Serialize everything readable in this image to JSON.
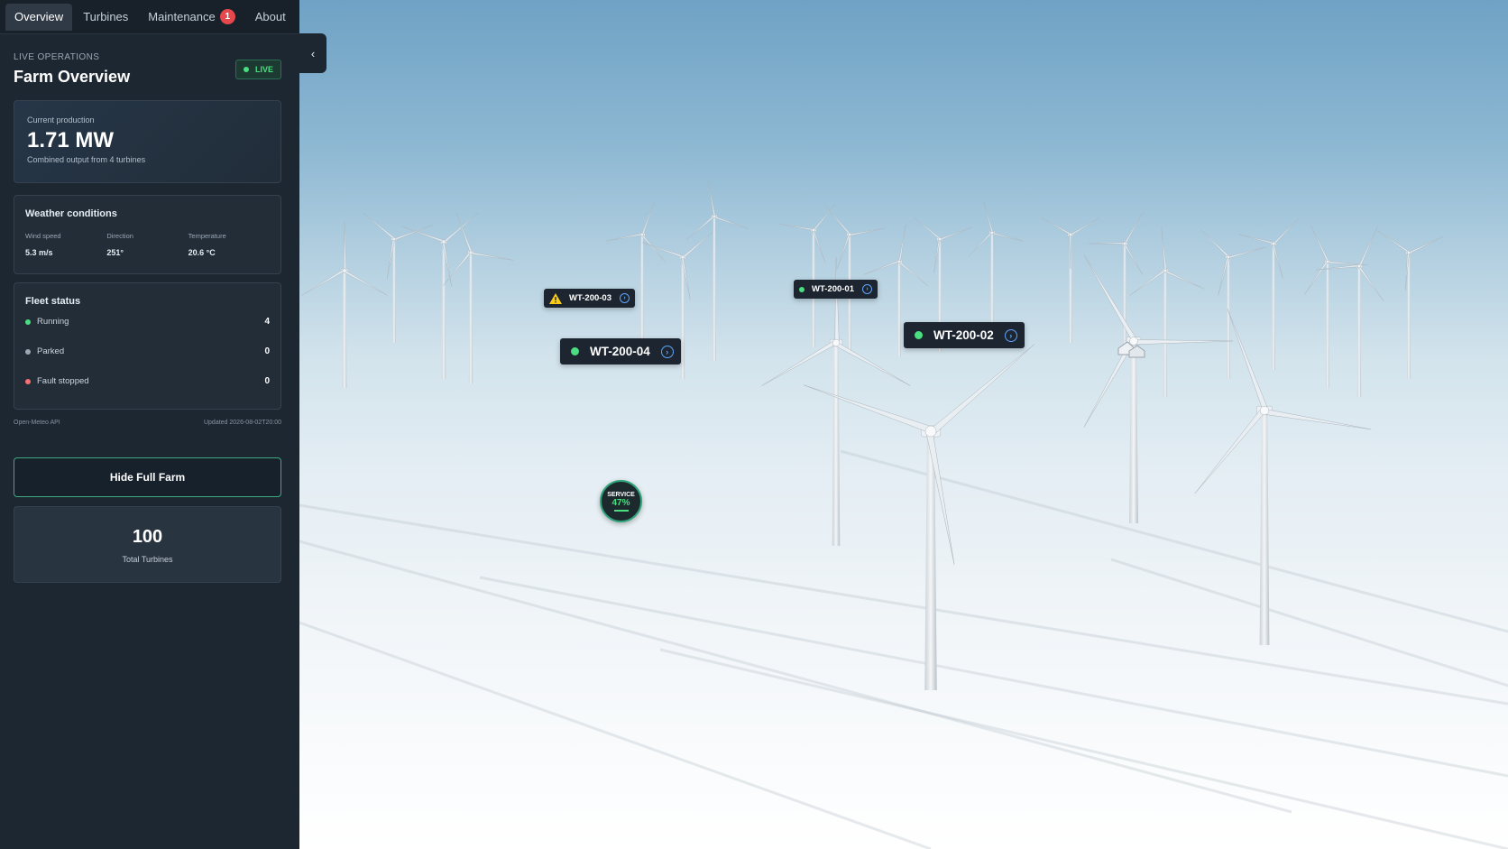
{
  "tabs": [
    {
      "label": "Overview",
      "active": true
    },
    {
      "label": "Turbines",
      "active": false
    },
    {
      "label": "Maintenance",
      "active": false,
      "badge": "1"
    },
    {
      "label": "About",
      "active": false
    }
  ],
  "header": {
    "eyebrow": "LIVE OPERATIONS",
    "title": "Farm Overview",
    "live_label": "LIVE"
  },
  "production": {
    "label": "Current production",
    "value": "1.71 MW",
    "sub": "Combined output from 4 turbines"
  },
  "weather": {
    "title": "Weather conditions",
    "items": [
      {
        "label": "Wind speed",
        "value": "5.3 m/s"
      },
      {
        "label": "Direction",
        "value": "251°"
      },
      {
        "label": "Temperature",
        "value": "20.6 °C"
      }
    ]
  },
  "fleet": {
    "title": "Fleet status",
    "items": [
      {
        "label": "Running",
        "count": "4",
        "color": "#4ade80"
      },
      {
        "label": "Parked",
        "count": "0",
        "color": "#9aa7b4"
      },
      {
        "label": "Fault stopped",
        "count": "0",
        "color": "#f87171"
      }
    ]
  },
  "meta": {
    "source": "Open-Meteo API",
    "updated": "Updated 2026-08-02T20:00"
  },
  "actions": {
    "hide_farm": "Hide Full Farm"
  },
  "total": {
    "value": "100",
    "label": "Total Turbines"
  },
  "turbines": [
    {
      "id": "WT-200-03",
      "status": "warning"
    },
    {
      "id": "WT-200-04",
      "status": "running"
    },
    {
      "id": "WT-200-01",
      "status": "running"
    },
    {
      "id": "WT-200-02",
      "status": "running"
    }
  ],
  "service": {
    "label": "SERVICE",
    "progress": "47%"
  },
  "colors": {
    "accent": "#3fa982",
    "running": "#4ade80",
    "warning": "#facc15",
    "fault": "#f87171",
    "info": "#60a5fa"
  }
}
